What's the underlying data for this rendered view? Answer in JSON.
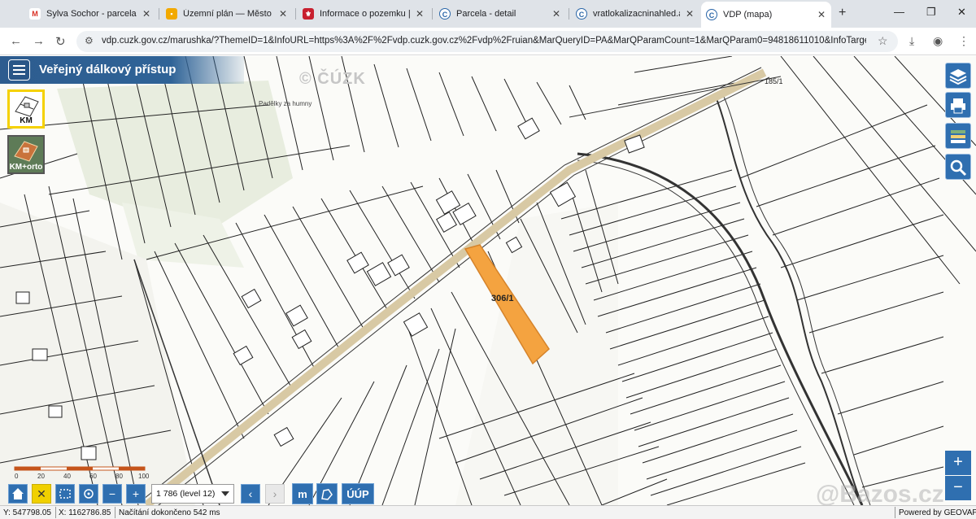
{
  "browser": {
    "tabs": [
      {
        "title": "Sylva Sochor - parcela obc",
        "icon": "gmail-icon",
        "color": "#d93025",
        "glyph": "M"
      },
      {
        "title": "Územní plán — Město Kr",
        "icon": "bookmark-icon",
        "color": "#f2a900",
        "glyph": "▪"
      },
      {
        "title": "Informace o pozemku | N",
        "icon": "crest-icon",
        "color": "#c8202f",
        "glyph": "⚜"
      },
      {
        "title": "Parcela - detail",
        "icon": "cuzk-icon",
        "color": "#2a66a8",
        "glyph": "C"
      },
      {
        "title": "vratlokalizacninahled.ashx",
        "icon": "cuzk-icon",
        "color": "#2a66a8",
        "glyph": "C"
      },
      {
        "title": "VDP (mapa)",
        "icon": "cuzk-icon",
        "color": "#2a66a8",
        "glyph": "C"
      }
    ],
    "active_tab": 5,
    "url": "vdp.cuzk.gov.cz/marushka/?ThemeID=1&InfoURL=https%3A%2F%2Fvdp.cuzk.gov.cz%2Fvdp%2Fruian&MarQueryID=PA&MarQParamCount=1&MarQParam0=94818611010&InfoTarget=vdp"
  },
  "app": {
    "title": "Veřejný dálkový přístup",
    "watermark": "© ČÚZK",
    "layers": [
      {
        "label": "KM",
        "selected": true
      },
      {
        "label": "KM+orto",
        "selected": false
      }
    ],
    "map": {
      "highlight_parcel": "306/1",
      "highlight_color": "#f4a340",
      "place_note": "Padělky za humny",
      "corner_label": "185/1"
    },
    "scale_labels": [
      "0",
      "20",
      "40",
      "60",
      "80",
      "100"
    ],
    "scale": "1 786 (level 12)",
    "buttons": {
      "uup": "ÚÚP",
      "m": "m"
    },
    "watermark_site": "@Bazos.cz"
  },
  "status": {
    "y": "Y: 547798.05",
    "x": "X: 1162786.85",
    "message": "Načítání dokončeno 542 ms",
    "powered": "Powered by GEOVAP"
  }
}
